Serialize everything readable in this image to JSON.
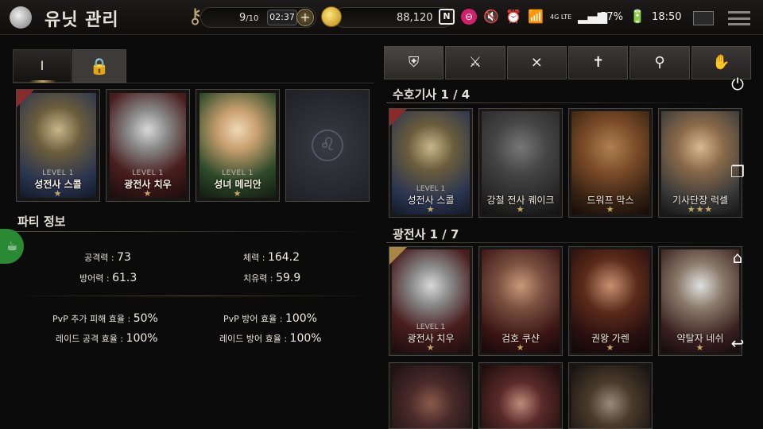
{
  "header": {
    "title": "유닛 관리",
    "key_count": "9",
    "key_max": "/10",
    "timer": "02:37",
    "gold": "88,120",
    "plus": "+"
  },
  "status_bar": {
    "nfc": "N",
    "network": "4G LTE",
    "battery": "57%",
    "time": "18:50"
  },
  "party_tabs": {
    "tab1_label": "I",
    "tab2_icon": "lock-icon"
  },
  "party": [
    {
      "level": "LEVEL 1",
      "name": "성전사 스콜",
      "stars": "★"
    },
    {
      "level": "LEVEL 1",
      "name": "광전사 치우",
      "stars": "★"
    },
    {
      "level": "LEVEL 1",
      "name": "성녀 메리안",
      "stars": "★"
    }
  ],
  "party_info": {
    "title": "파티 정보",
    "attack_label": "공격력 : ",
    "attack_value": "73",
    "hp_label": "체력 : ",
    "hp_value": "164.2",
    "defense_label": "방어력 : ",
    "defense_value": "61.3",
    "heal_label": "치유력 : ",
    "heal_value": "59.9",
    "pvp_damage_label": "PvP 추가 피해 효율 : ",
    "pvp_damage_value": "50%",
    "pvp_defense_label": "PvP 방어 효율 : ",
    "pvp_defense_value": "100%",
    "raid_attack_label": "레이드 공격 효율 : ",
    "raid_attack_value": "100%",
    "raid_defense_label": "레이드 방어 효율 : ",
    "raid_defense_value": "100%"
  },
  "class_tabs": [
    "shield-icon",
    "crossed-swords-icon",
    "crossed-x-icon",
    "cross-icon",
    "staff-icon",
    "hand-icon"
  ],
  "sections": [
    {
      "title": "수호기사 1 / 4",
      "units": [
        {
          "level": "LEVEL 1",
          "name": "성전사 스콜",
          "stars": "★"
        },
        {
          "level": "",
          "name": "강철 전사 퀘이크",
          "stars": "★"
        },
        {
          "level": "",
          "name": "드워프 막스",
          "stars": "★"
        },
        {
          "level": "",
          "name": "기사단장 럭셀",
          "stars": "★★★"
        }
      ]
    },
    {
      "title": "광전사 1 / 7",
      "units": [
        {
          "level": "LEVEL 1",
          "name": "광전사 치우",
          "stars": "★"
        },
        {
          "level": "",
          "name": "검호 쿠샨",
          "stars": "★"
        },
        {
          "level": "",
          "name": "권왕 가렌",
          "stars": "★"
        },
        {
          "level": "",
          "name": "약탈자 네쉬",
          "stars": "★"
        }
      ]
    }
  ]
}
